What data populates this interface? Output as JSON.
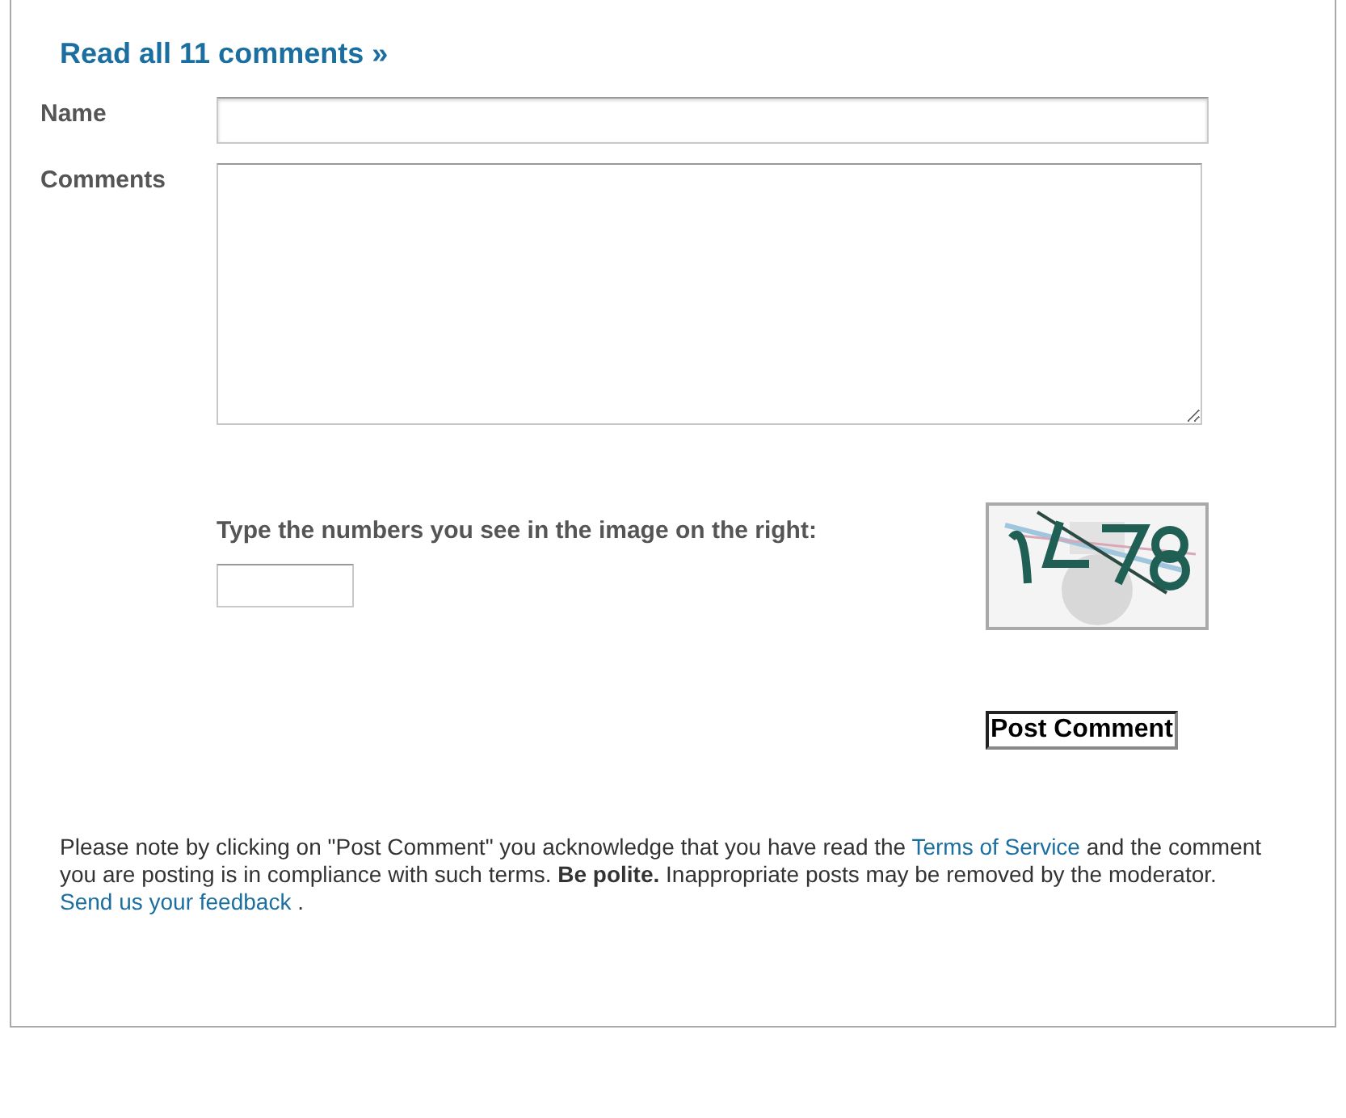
{
  "read_all_link": "Read all 11 comments »",
  "form": {
    "name_label": "Name",
    "comments_label": "Comments",
    "captcha_prompt": "Type the numbers you see in the image on the right:",
    "submit_button": "Post Comment"
  },
  "notice": {
    "before": "Please note by clicking on \"Post Comment\" you acknowledge that you have read the ",
    "terms_link": "Terms of Service",
    "middle": " and the comment you are posting is in compliance with such terms. **Be polite.** Inappropriate posts may be removed by the moderator. ",
    "feedback_link": "Send us your feedback",
    "after": " ."
  }
}
